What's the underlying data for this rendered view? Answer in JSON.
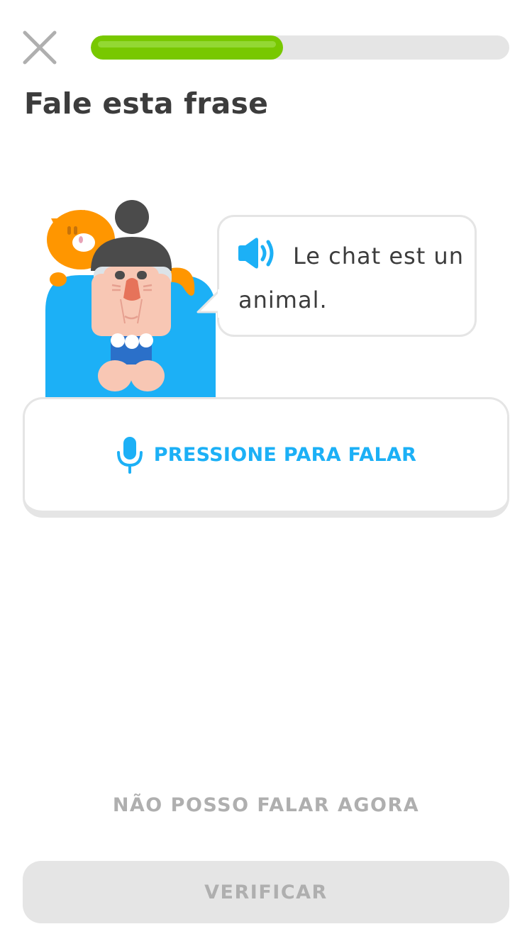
{
  "header": {
    "close_icon": "close-icon",
    "progress_fraction": 0.46
  },
  "prompt": {
    "title": "Fale esta frase"
  },
  "exercise": {
    "character_icon": "character-with-cat-illustration",
    "speaker_icon": "speaker-icon",
    "sentence": "Le chat est un animal."
  },
  "speak_button": {
    "icon": "microphone-icon",
    "label": "PRESSIONE PARA FALAR"
  },
  "footer": {
    "cant_speak_label": "NÃO POSSO FALAR AGORA",
    "check_label": "VERIFICAR"
  },
  "colors": {
    "progress": "#78c800",
    "accent_blue": "#1cb0f6",
    "disabled_text": "#afafaf",
    "disabled_bg": "#e5e5e5",
    "title_text": "#3c3c3c"
  }
}
